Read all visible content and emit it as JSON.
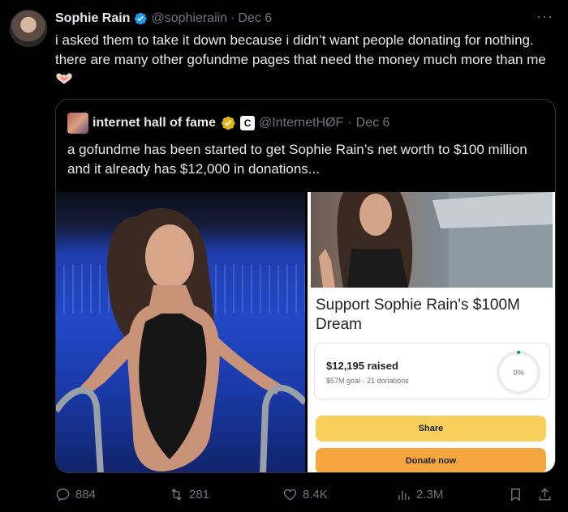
{
  "post": {
    "author_name": "Sophie Rain",
    "handle": "@sophieraiin",
    "separator": "·",
    "date": "Dec 6",
    "text": "i asked them to take it down because i didn’t want people donating for nothing. there are many other gofundme pages that need the money much more than me",
    "emoji_icon": "heart-hands-icon"
  },
  "quote": {
    "author_name": "internet hall of fame",
    "handle": "@InternetHØF",
    "separator": "·",
    "date": "Dec 6",
    "badge_letter": "C",
    "text": "a gofundme has been started to get Sophie Rain’s net worth to $100 million and it already has $12,000 in donations...",
    "gofundme": {
      "title": "Support Sophie Rain's $100M Dream",
      "raised": "$12,195 raised",
      "goal": "$57M goal",
      "dot": "·",
      "donations": "21 donations",
      "percent": "0%",
      "progress_fraction": 0.0002,
      "share_label": "Share",
      "donate_label": "Donate now",
      "colors": {
        "share": "#f8cf5a",
        "donate": "#f6a63e",
        "progress": "#02a95c"
      }
    }
  },
  "actions": {
    "replies": "884",
    "reposts": "281",
    "likes": "8.4K",
    "views": "2.3M"
  },
  "colors": {
    "verified_blue": "#1d9bf0",
    "verified_gold": "#e2b719",
    "muted": "#71767b"
  }
}
